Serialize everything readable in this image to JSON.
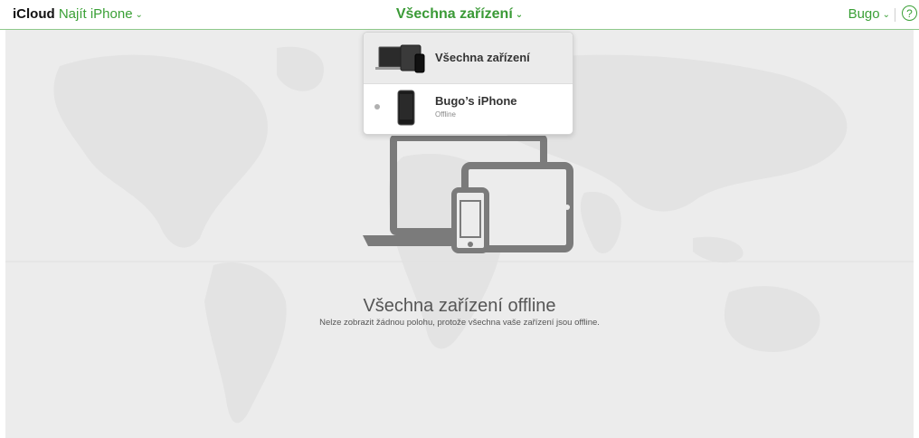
{
  "header": {
    "brand": "iCloud",
    "app_name": "Najít iPhone",
    "center_title": "Všechna zařízení",
    "user_name": "Bugo",
    "help_label": "?"
  },
  "dropdown": {
    "items": [
      {
        "title": "Všechna zařízení",
        "icon": "all-devices-icon"
      },
      {
        "title": "Bugo’s iPhone",
        "subtitle": "Offline",
        "status": "offline",
        "icon": "iphone-icon"
      }
    ]
  },
  "main": {
    "title": "Všechna zařízení offline",
    "subtitle": "Nelze zobrazit žádnou polohu, protože všechna vaše zařízení jsou offline."
  },
  "colors": {
    "accent": "#3aa036",
    "map_bg": "#ececec",
    "device_gray": "#7b7b7b"
  }
}
